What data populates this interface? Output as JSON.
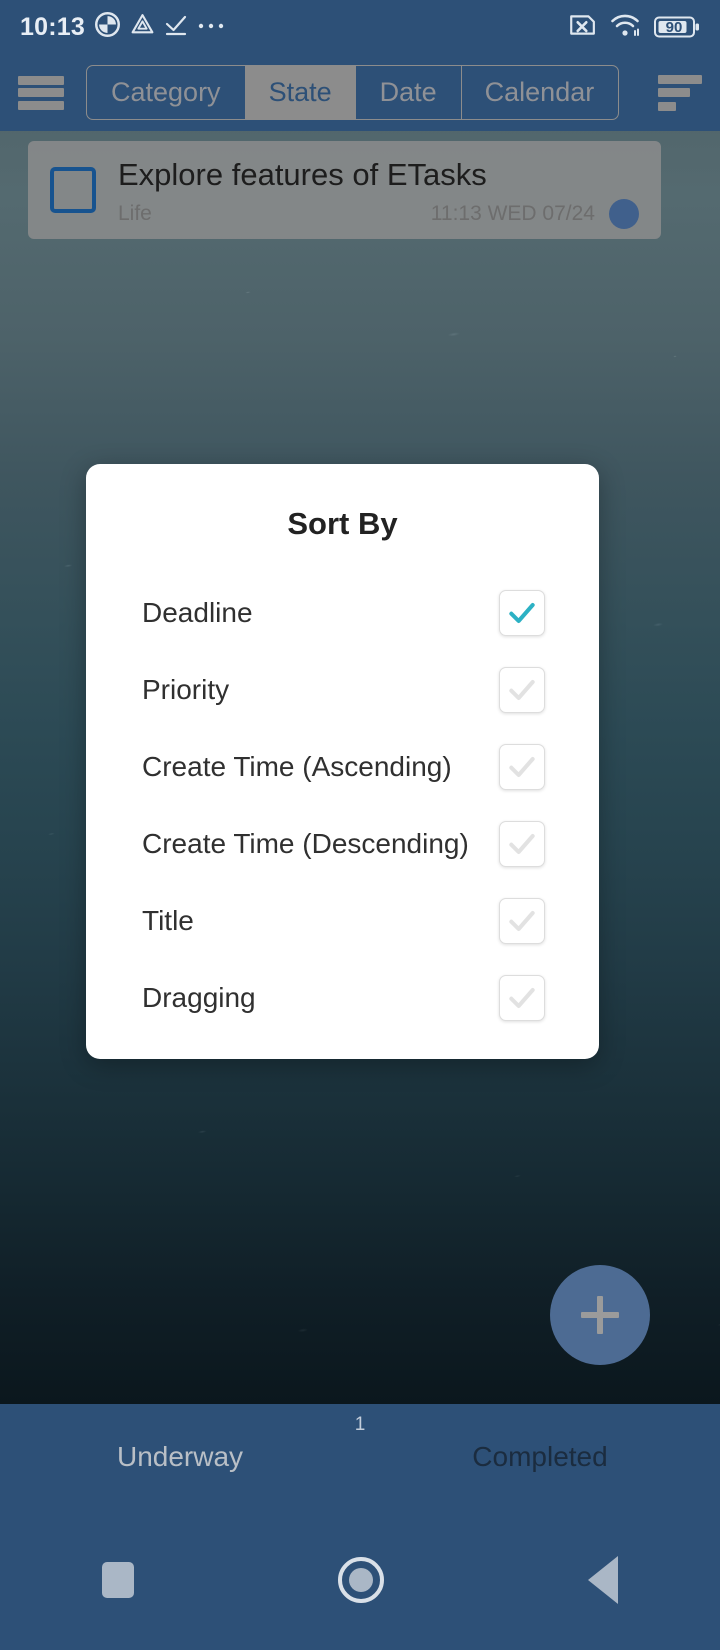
{
  "status_bar": {
    "clock": "10:13",
    "battery_level": "90",
    "icons": [
      "sync-icon",
      "drive-icon",
      "download-complete-icon",
      "more-notifications-icon",
      "sim-disabled-icon",
      "wifi-icon",
      "battery-icon"
    ]
  },
  "app_bar": {
    "menu_icon": "hamburger-menu-icon",
    "sort_icon": "sort-bars-icon",
    "segments": [
      {
        "label": "Category",
        "selected": false
      },
      {
        "label": "State",
        "selected": true
      },
      {
        "label": "Date",
        "selected": false
      },
      {
        "label": "Calendar",
        "selected": false
      }
    ]
  },
  "task_list": {
    "items": [
      {
        "title": "Explore features of ETasks",
        "category": "Life",
        "time": "11:13 WED 07/24",
        "checked": false,
        "dot_color": "#40608c"
      }
    ]
  },
  "sort_dialog": {
    "title": "Sort By",
    "options": [
      {
        "label": "Deadline",
        "checked": true
      },
      {
        "label": "Priority",
        "checked": false
      },
      {
        "label": "Create Time (Ascending)",
        "checked": false
      },
      {
        "label": "Create Time (Descending)",
        "checked": false
      },
      {
        "label": "Title",
        "checked": false
      },
      {
        "label": "Dragging",
        "checked": false
      }
    ],
    "checked_color": "#2cb1c4",
    "unchecked_color": "#e2e2e2"
  },
  "fab": {
    "icon": "plus-icon",
    "label": "+"
  },
  "bottom_tabs": {
    "badge": "1",
    "tabs": [
      {
        "label": "Underway",
        "active": true
      },
      {
        "label": "Completed",
        "active": false
      }
    ]
  },
  "nav_bar": {
    "recent_label": "recent-apps-icon",
    "home_label": "home-icon",
    "back_label": "back-icon"
  },
  "theme": {
    "chrome_blue": "#2d5077",
    "accent_teal": "#2cb1c4"
  }
}
